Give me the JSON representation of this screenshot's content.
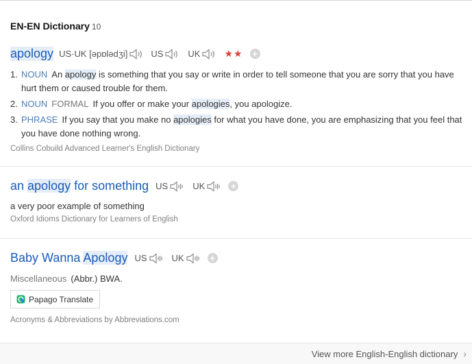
{
  "section": {
    "title": "EN-EN Dictionary",
    "count": "10"
  },
  "entries": [
    {
      "headword": "apology",
      "pronunciation": "US·UK [əpɒlədʒi]",
      "accents": [
        "US",
        "UK"
      ],
      "stars": "★★",
      "definitions": [
        {
          "num": "1.",
          "pos": "NOUN",
          "parts": [
            "An ",
            "apology",
            " is something that you say or write in order to tell someone that you are sorry that you have hurt them or caused trouble for them."
          ]
        },
        {
          "num": "2.",
          "pos": "NOUN",
          "register": "FORMAL",
          "parts": [
            "If you offer or make your ",
            "apologies",
            ", you apologize."
          ]
        },
        {
          "num": "3.",
          "pos": "PHRASE",
          "parts": [
            "If you say that you make no ",
            "apologies",
            " for what you have done, you are emphasizing that you feel that you have done nothing wrong."
          ]
        }
      ],
      "source": "Collins Cobuild Advanced Learner's English Dictionary"
    },
    {
      "headword_parts": [
        "an ",
        "apology",
        " for something"
      ],
      "accents": [
        "US",
        "UK"
      ],
      "definition": "a very poor example of something",
      "source": "Oxford Idioms Dictionary for Learners of English"
    },
    {
      "headword_parts": [
        "Baby Wanna ",
        "Apology"
      ],
      "accents": [
        "US",
        "UK"
      ],
      "label": "Miscellaneous",
      "definition": "(Abbr.) BWA.",
      "papago_label": "Papago Translate",
      "source": "Acronyms & Abbreviations by Abbreviations.com"
    }
  ],
  "footer": {
    "more_link": "View more English-English dictionary",
    "chevron": "›"
  },
  "colors": {
    "headword": "#1a5cb8",
    "highlight": "#e5eef8",
    "stars": "#d9453b"
  },
  "icons": {
    "speaker": "speaker-icon",
    "add": "plus-circle-icon",
    "papago": "papago-logo-icon",
    "chevron": "chevron-right-icon"
  }
}
